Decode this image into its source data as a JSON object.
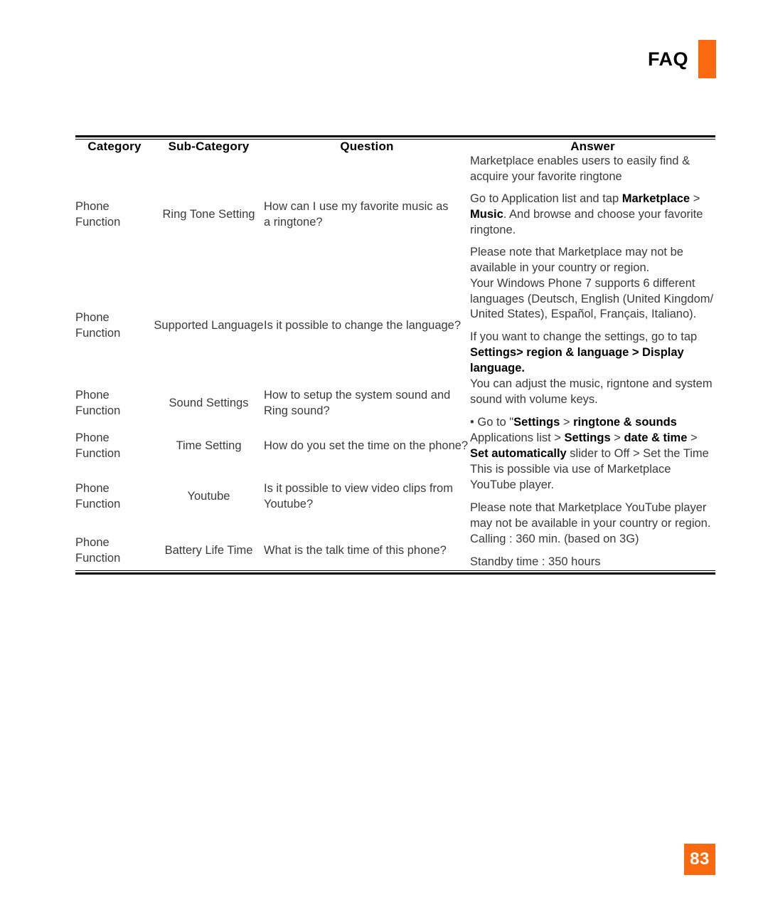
{
  "header": {
    "title": "FAQ",
    "accent_color": "#f96a10"
  },
  "table": {
    "columns": [
      "Category",
      "Sub-Category",
      "Question",
      "Answer"
    ],
    "rows": [
      {
        "category_line1": "Phone",
        "category_line2": "Function",
        "sub_category": "Ring Tone Setting",
        "question_line1": "How can I use my favorite music as",
        "question_line2": "a ringtone?",
        "answer": [
          [
            {
              "t": "Marketplace enables users to easily find & acquire your favorite ringtone",
              "b": false
            }
          ],
          [
            {
              "t": "Go to Application list and tap ",
              "b": false
            },
            {
              "t": "Marketplace",
              "b": true
            },
            {
              "t": " > ",
              "b": false
            },
            {
              "t": "Music",
              "b": true
            },
            {
              "t": ". And browse and choose your favorite ringtone.",
              "b": false
            }
          ],
          [
            {
              "t": "Please note that Marketplace may not be available in your country or region.",
              "b": false
            }
          ]
        ]
      },
      {
        "category_line1": "Phone",
        "category_line2": "Function",
        "sub_category": "Supported Language",
        "question_line1": "Is it possible to change the language?",
        "question_line2": "",
        "answer": [
          [
            {
              "t": "Your Windows Phone 7 supports 6 different languages (Deutsch, English (United Kingdom/ United States), Español, Français, Italiano).",
              "b": false
            }
          ],
          [
            {
              "t": "If you want to change the settings, go to tap ",
              "b": false
            },
            {
              "t": "Settings> region & language > Display language.",
              "b": true
            }
          ]
        ]
      },
      {
        "category_line1": "Phone",
        "category_line2": "Function",
        "sub_category": "Sound Settings",
        "question_line1": "How to setup the system sound and",
        "question_line2": "Ring sound?",
        "answer": [
          [
            {
              "t": "You can adjust the music, rigntone and system sound with volume keys.",
              "b": false
            }
          ],
          [
            {
              "t": "• Go to \"",
              "b": false
            },
            {
              "t": "Settings",
              "b": true
            },
            {
              "t": " > ",
              "b": false
            },
            {
              "t": "ringtone & sounds",
              "b": true
            }
          ]
        ]
      },
      {
        "category_line1": "Phone",
        "category_line2": "Function",
        "sub_category": "Time Setting",
        "question_line1": "How do you set the time on the phone?",
        "question_line2": "",
        "answer": [
          [
            {
              "t": "Applications list > ",
              "b": false
            },
            {
              "t": "Settings",
              "b": true
            },
            {
              "t": " > ",
              "b": false
            },
            {
              "t": "date & time",
              "b": true
            },
            {
              "t": " > ",
              "b": false
            },
            {
              "t": "Set automatically",
              "b": true
            },
            {
              "t": " slider to Off > Set the Time",
              "b": false
            }
          ]
        ]
      },
      {
        "category_line1": "Phone",
        "category_line2": "Function",
        "sub_category": "Youtube",
        "question_line1": "Is it possible to view video clips from",
        "question_line2": "Youtube?",
        "answer": [
          [
            {
              "t": "This is possible via use of Marketplace YouTube player.",
              "b": false
            }
          ],
          [
            {
              "t": "Please note that Marketplace YouTube player may not be available in your country or region.",
              "b": false
            }
          ]
        ]
      },
      {
        "category_line1": "Phone",
        "category_line2": "Function",
        "sub_category": "Battery Life Time",
        "question_line1": "What is the talk time of this phone?",
        "question_line2": "",
        "answer": [
          [
            {
              "t": "Calling : 360 min. (based on 3G)",
              "b": false
            }
          ],
          [
            {
              "t": "Standby time : 350 hours",
              "b": false
            }
          ]
        ]
      }
    ]
  },
  "footer": {
    "page_number": "83",
    "badge_color": "#f96a10"
  }
}
